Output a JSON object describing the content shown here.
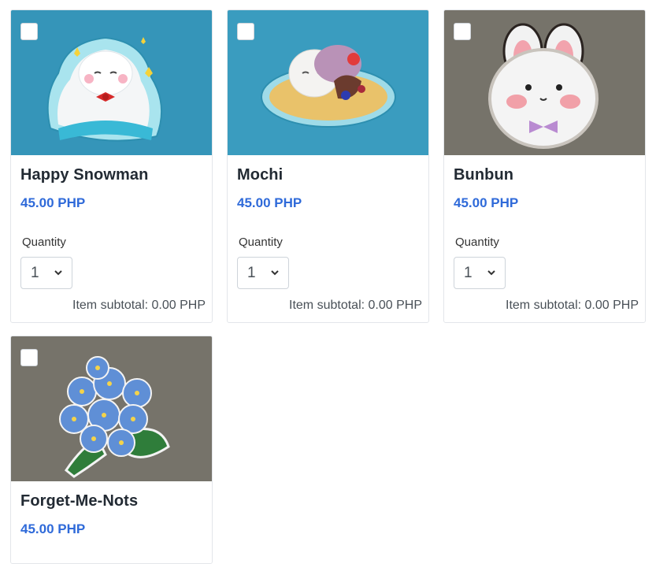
{
  "products": [
    {
      "name": "Happy Snowman",
      "price": "45.00 PHP",
      "quantity_label": "Quantity",
      "quantity_value": "1",
      "subtotal": "Item subtotal: 0.00 PHP",
      "image": "happy-snowman-patch-image"
    },
    {
      "name": "Mochi",
      "price": "45.00 PHP",
      "quantity_label": "Quantity",
      "quantity_value": "1",
      "subtotal": "Item subtotal: 0.00 PHP",
      "image": "mochi-patch-image"
    },
    {
      "name": "Bunbun",
      "price": "45.00 PHP",
      "quantity_label": "Quantity",
      "quantity_value": "1",
      "subtotal": "Item subtotal: 0.00 PHP",
      "image": "bunbun-patch-image"
    },
    {
      "name": "Forget-Me-Nots",
      "price": "45.00 PHP",
      "image": "forget-me-nots-patch-image"
    }
  ],
  "colors": {
    "accent": "#2f6ad9",
    "teal_bg": "#3a9cbf",
    "gray_bg": "#7e7a70"
  }
}
